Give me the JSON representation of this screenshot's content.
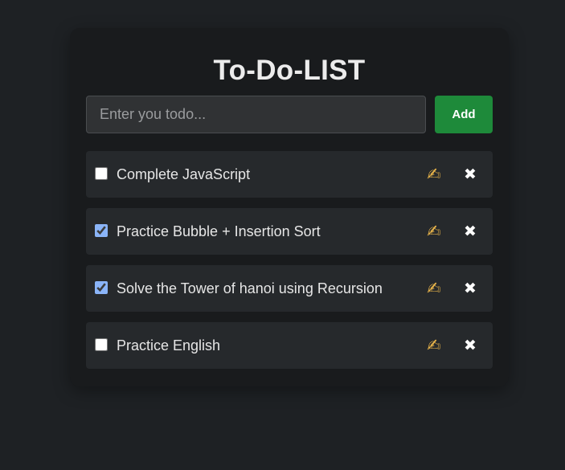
{
  "app": {
    "title": "To-Do-LIST"
  },
  "input": {
    "placeholder": "Enter you todo...",
    "value": ""
  },
  "add_button": {
    "label": "Add"
  },
  "todos": [
    {
      "text": "Complete JavaScript",
      "checked": false,
      "edit_icon": "✍",
      "delete_icon": "✖"
    },
    {
      "text": "Practice Bubble + Insertion Sort",
      "checked": true,
      "edit_icon": "✍",
      "delete_icon": "✖"
    },
    {
      "text": "Solve the Tower of hanoi using Recursion",
      "checked": true,
      "edit_icon": "✍",
      "delete_icon": "✖"
    },
    {
      "text": "Practice English",
      "checked": false,
      "edit_icon": "✍",
      "delete_icon": "✖"
    }
  ],
  "colors": {
    "background": "#1e2124",
    "card": "#191b1d",
    "item": "#26292c",
    "add_button": "#1e8a3a",
    "checkbox_accent": "#8ab4f8",
    "edit_icon": "#e8b44a"
  }
}
